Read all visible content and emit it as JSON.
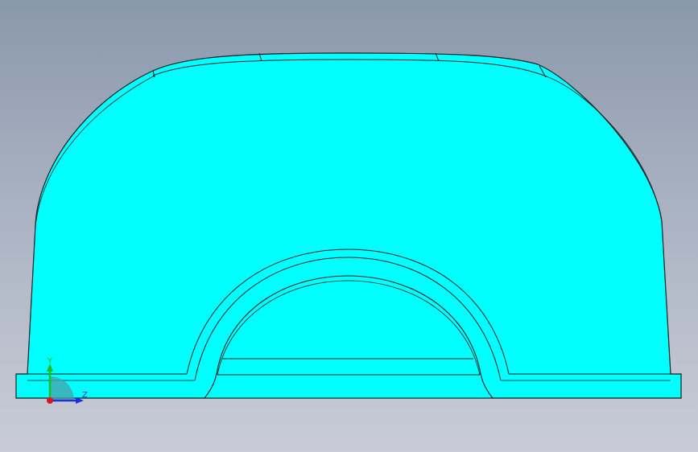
{
  "viewport": {
    "model_fill_color": "#00ffff",
    "edge_color": "#1a2a2a",
    "background_top_color": "#8a98ac",
    "background_bottom_color": "#c9ccd6"
  },
  "triad": {
    "y_label": "Y",
    "z_label": "Z",
    "y_color": "#19c219",
    "z_color": "#1a2ee0",
    "origin_color": "#e0101a",
    "quadrant_color": "#4aa0a8"
  }
}
